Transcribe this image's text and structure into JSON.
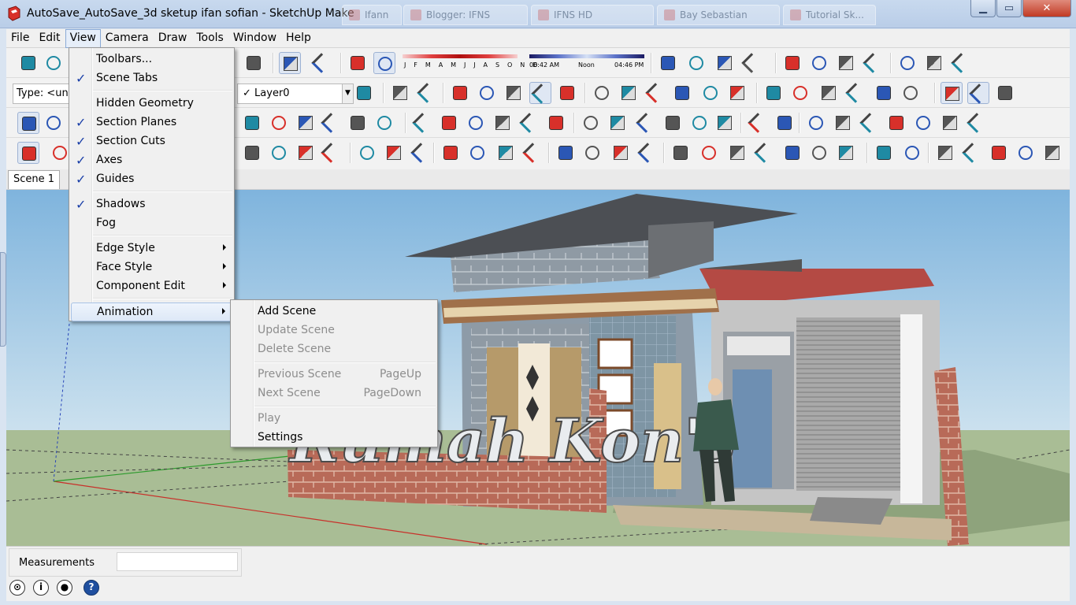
{
  "window": {
    "title": "AutoSave_AutoSave_3d sketup ifan sofian - SketchUp Make",
    "minimize_glyph": "▁",
    "maximize_glyph": "▭",
    "close_glyph": "✕",
    "background_tabs": [
      "Ifann",
      "Blogger: IFNS",
      "IFNS HD",
      "Bay Sebastian",
      "Tutorial Sk..."
    ]
  },
  "menubar": [
    "File",
    "Edit",
    "View",
    "Camera",
    "Draw",
    "Tools",
    "Window",
    "Help"
  ],
  "toolbar": {
    "type_field": "Type: <und",
    "layer_check": "✓",
    "layer_name": "Layer0",
    "shadow_months": "J F M A M J J A S O N D",
    "time_start": "06:42 AM",
    "time_noon": "Noon",
    "time_end": "04:46 PM"
  },
  "scene_tab": "Scene 1",
  "view_menu": {
    "items": [
      {
        "label": "Toolbars...",
        "checked": false,
        "submenu": false
      },
      {
        "label": "Scene Tabs",
        "checked": true,
        "submenu": false
      },
      {
        "label": "Hidden Geometry",
        "checked": false,
        "submenu": false
      },
      {
        "label": "Section Planes",
        "checked": true,
        "submenu": false
      },
      {
        "label": "Section Cuts",
        "checked": true,
        "submenu": false
      },
      {
        "label": "Axes",
        "checked": true,
        "submenu": false
      },
      {
        "label": "Guides",
        "checked": true,
        "submenu": false
      },
      {
        "label": "Shadows",
        "checked": true,
        "submenu": false
      },
      {
        "label": "Fog",
        "checked": false,
        "submenu": false
      },
      {
        "label": "Edge Style",
        "checked": false,
        "submenu": true
      },
      {
        "label": "Face Style",
        "checked": false,
        "submenu": true
      },
      {
        "label": "Component Edit",
        "checked": false,
        "submenu": true
      },
      {
        "label": "Animation",
        "checked": false,
        "submenu": true
      }
    ],
    "check_glyph": "✓"
  },
  "animation_menu": {
    "items": [
      {
        "label": "Add Scene",
        "shortcut": "",
        "enabled": true
      },
      {
        "label": "Update Scene",
        "shortcut": "",
        "enabled": false
      },
      {
        "label": "Delete Scene",
        "shortcut": "",
        "enabled": false
      },
      {
        "label": "Previous Scene",
        "shortcut": "PageUp",
        "enabled": false
      },
      {
        "label": "Next Scene",
        "shortcut": "PageDown",
        "enabled": false
      },
      {
        "label": "Play",
        "shortcut": "",
        "enabled": false
      },
      {
        "label": "Settings",
        "shortcut": "",
        "enabled": true
      }
    ]
  },
  "viewport": {
    "sign_text": "Rumah Kon's"
  },
  "status": {
    "measurements_label": "Measurements",
    "measurements_value": "",
    "info_glyph": "i",
    "help_glyph": "?"
  },
  "colors": {
    "sky": "#8fbee0",
    "ground": "#a8bd94",
    "check_blue": "#1a3fa8",
    "close_red": "#c13a24"
  }
}
